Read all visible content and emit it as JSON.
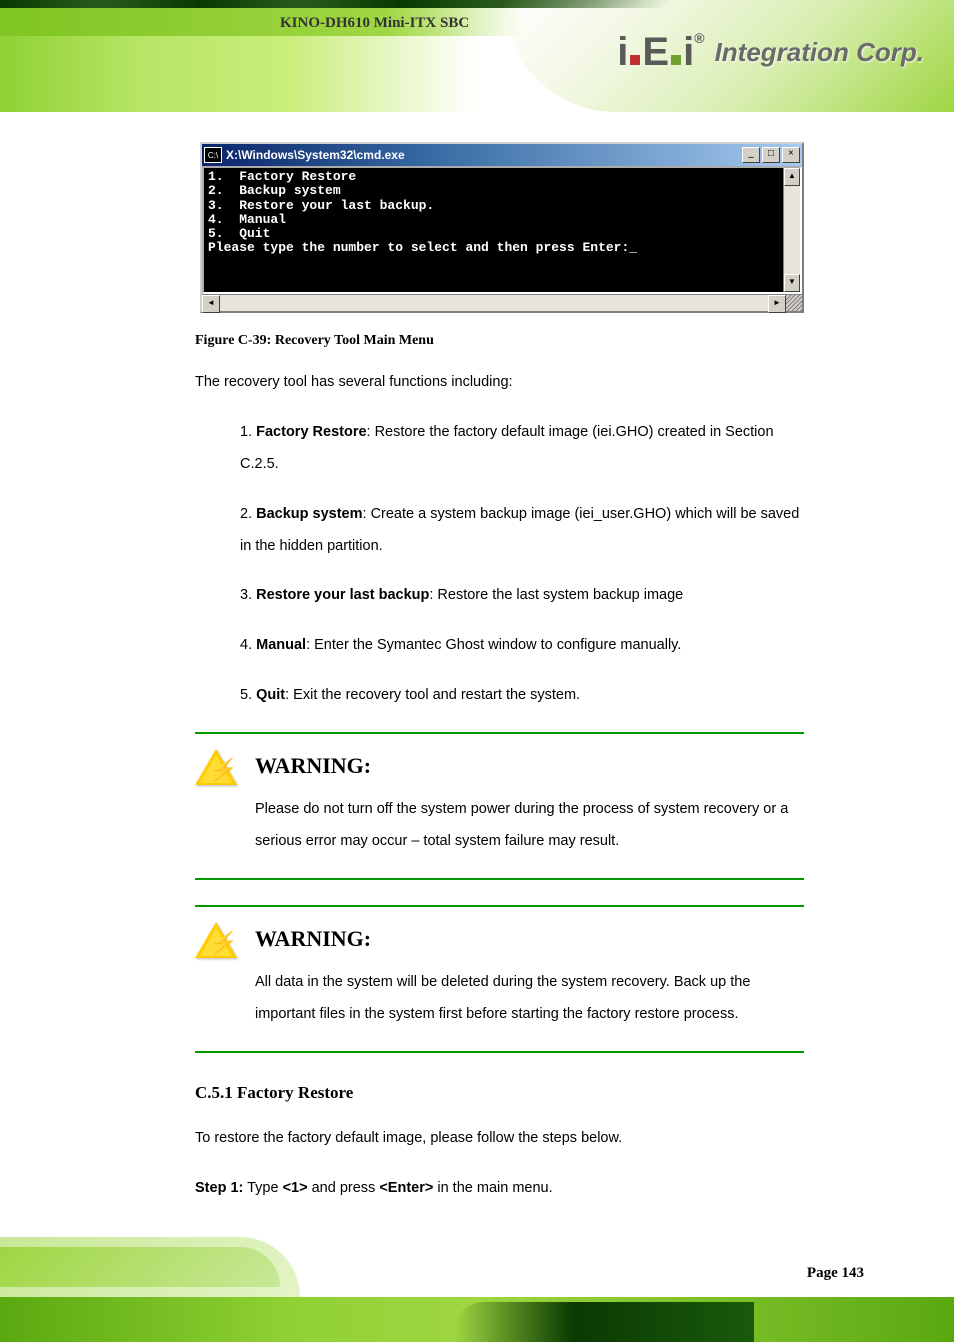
{
  "header": {
    "manual_title": "KINO-DH610 Mini-ITX SBC",
    "logo_brand": "iEi",
    "logo_text": "Integration Corp."
  },
  "cmd_window": {
    "title": "X:\\Windows\\System32\\cmd.exe",
    "icon_label": "C:\\",
    "minimize": "_",
    "maximize": "□",
    "close": "×",
    "lines": [
      "1.  Factory Restore",
      "2.  Backup system",
      "3.  Restore your last backup.",
      "4.  Manual",
      "5.  Quit",
      "Please type the number to select and then press Enter:_"
    ],
    "up_arrow": "▲",
    "down_arrow": "▼",
    "left_arrow": "◄",
    "right_arrow": "►"
  },
  "figure": {
    "caption": "Figure C-39: Recovery Tool Main Menu"
  },
  "body": {
    "intro": "The recovery tool has several functions including:",
    "items": [
      {
        "num": "1.",
        "title": "Factory Restore",
        "desc": ": Restore the factory default image (iei.GHO) created in Section C.2.5."
      },
      {
        "num": "2.",
        "title": "Backup system",
        "desc": ": Create a system backup image (iei_user.GHO) which will be saved in the hidden partition."
      },
      {
        "num": "3.",
        "title": "Restore your last backup",
        "desc": ": Restore the last system backup image"
      },
      {
        "num": "4.",
        "title": "Manual",
        "desc": ": Enter the Symantec Ghost window to configure manually."
      },
      {
        "num": "5.",
        "title": "Quit",
        "desc": ": Exit the recovery tool and restart the system."
      }
    ]
  },
  "section": {
    "heading": "C.5.1  Factory Restore"
  },
  "warnings": {
    "label": "WARNING:",
    "w1": "Please do not turn off the system power during the process of system recovery or a serious error may occur – total system failure may result.",
    "w2": "All data in the system will be deleted during the system recovery. Back up the important files in the system first before starting the factory restore process."
  },
  "body2": {
    "text": "To restore the factory default image, please follow the steps below."
  },
  "step": {
    "prefix": "Step 1:",
    "text_a": "Type ",
    "bold": "<1>",
    "text_b": " and press ",
    "bold2": "<Enter>",
    "text_c": " in the main menu."
  },
  "footer": {
    "page": "Page 143"
  }
}
